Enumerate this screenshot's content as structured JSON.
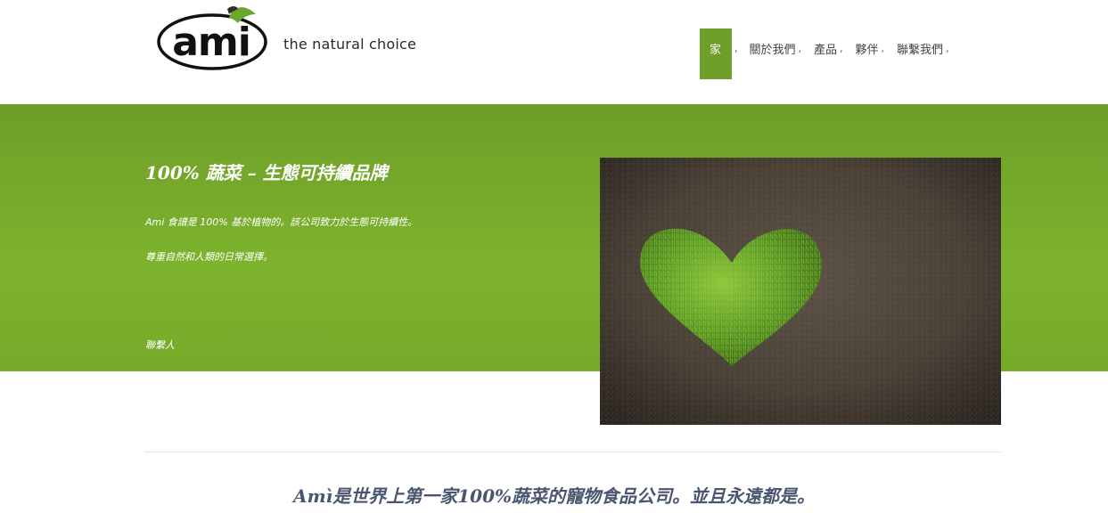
{
  "brand": {
    "logo_text": "ami",
    "tagline": "the natural choice"
  },
  "nav": {
    "items": [
      {
        "label": "家",
        "active": true
      },
      {
        "label": "關於我們",
        "active": false
      },
      {
        "label": "產品",
        "active": false
      },
      {
        "label": "夥伴",
        "active": false
      },
      {
        "label": "聯繫我們",
        "active": false
      }
    ],
    "separator": ","
  },
  "hero": {
    "title": "100% 蔬菜 – 生態可持續品牌",
    "paragraph_1": "Ami 食譜是 100% 基於植物的。該公司致力於生態可持續性。",
    "paragraph_2": "尊重自然和人類的日常選擇。",
    "contact_link": "聯繫人",
    "image_icon": "grass-heart-on-soil-image"
  },
  "statement": "Amì是世界上第一家100%蔬菜的寵物食品公司。並且永遠都是。",
  "colors": {
    "accent_green": "#6f9f2b",
    "hero_green": "#7db32d",
    "statement_text": "#4a5670"
  }
}
